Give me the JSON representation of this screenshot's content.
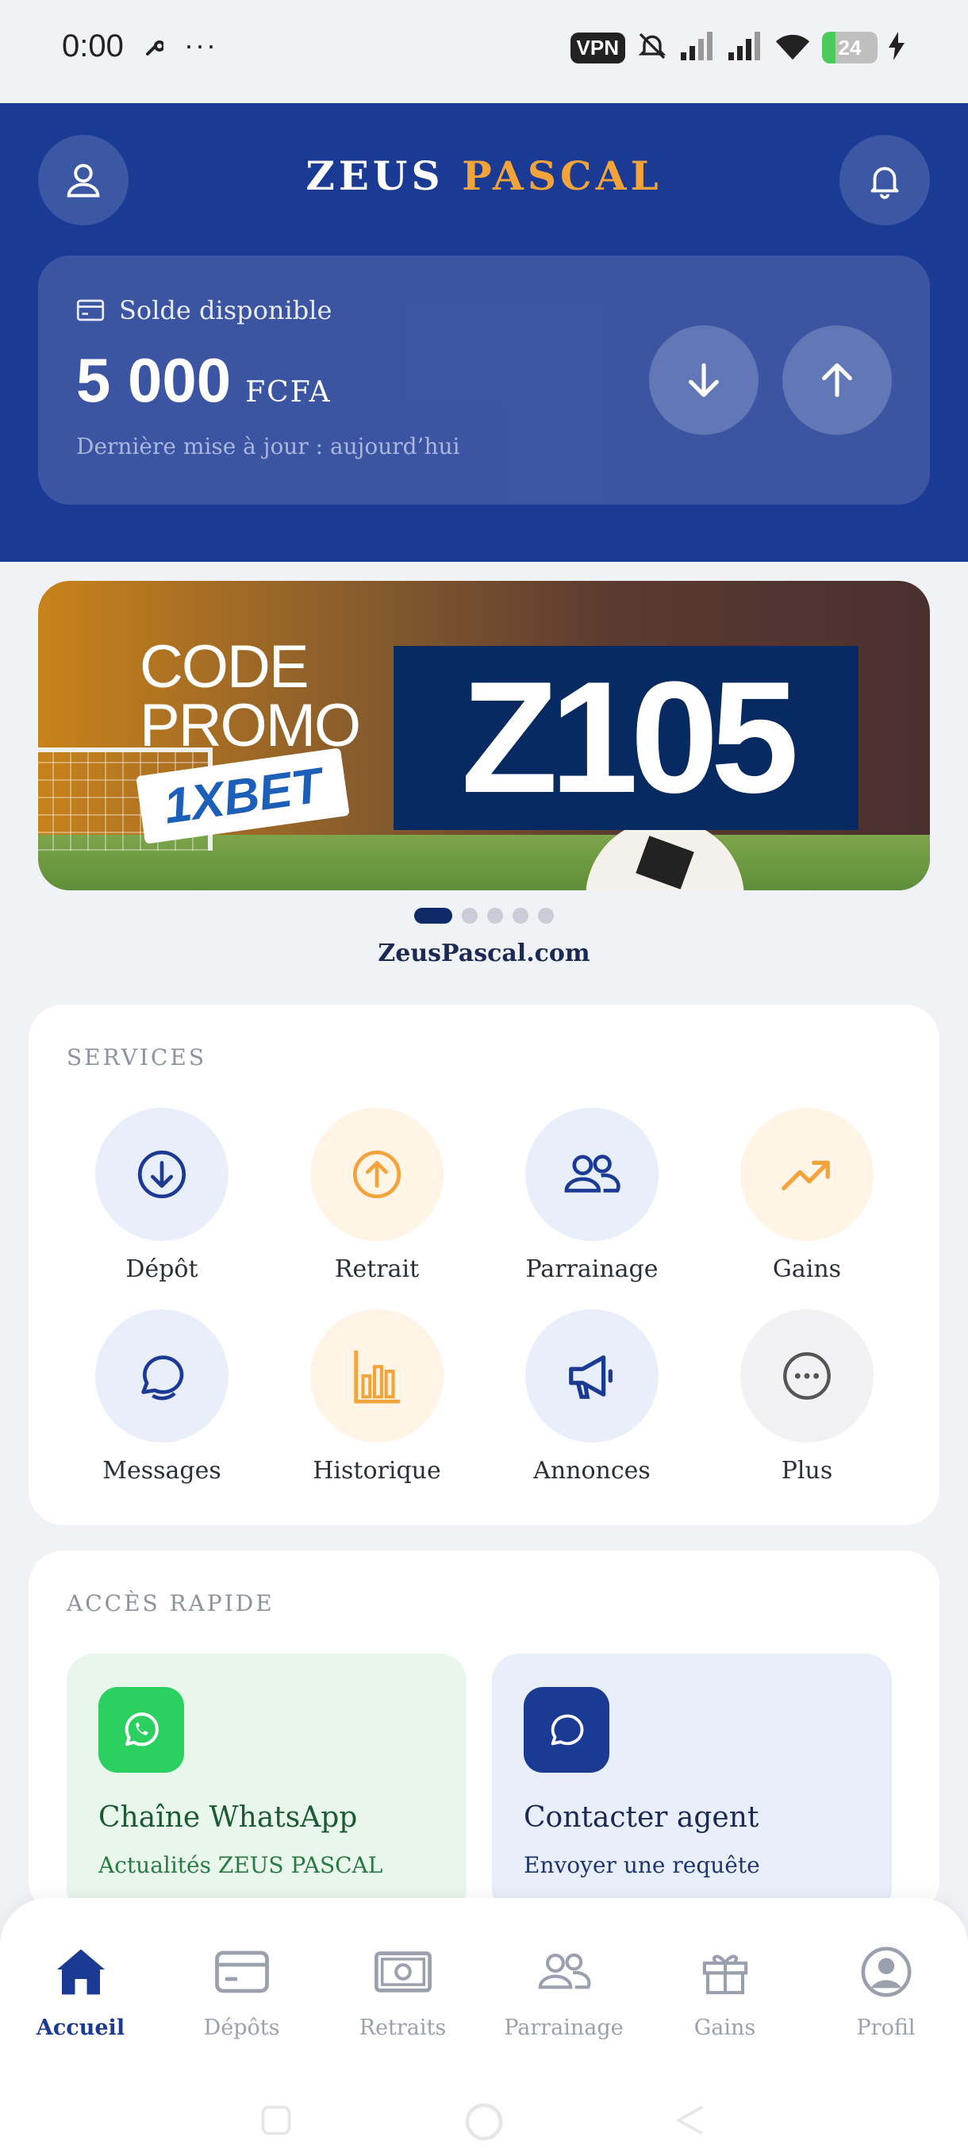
{
  "status_bar": {
    "time": "0:00",
    "dots": "···",
    "vpn": "VPN",
    "battery": "24",
    "icons": [
      "wrench-icon",
      "more-icon",
      "vpn-badge",
      "bell-off-icon",
      "signal-icon",
      "signal-icon",
      "wifi-icon",
      "battery-icon",
      "charging-icon"
    ]
  },
  "header": {
    "brand_part1": "ZEUS",
    "brand_part2": "PASCAL",
    "colors": {
      "primary": "#1b3a94",
      "accent": "#f2a43a"
    }
  },
  "balance": {
    "label": "Solde disponible",
    "amount": "5 000",
    "currency": "FCFA",
    "updated": "Dernière mise à jour : aujourd’hui",
    "actions": [
      "deposit-arrow-down",
      "withdraw-arrow-up"
    ]
  },
  "banner": {
    "line1": "CODE",
    "line2": "PROMO",
    "brand": "1XBET",
    "code": "Z105",
    "slides": 5,
    "active_slide": 1,
    "site": "ZeusPascal.com"
  },
  "services": {
    "title": "SERVICES",
    "items": [
      {
        "label": "Dépôt",
        "icon": "arrow-down-circle-icon"
      },
      {
        "label": "Retrait",
        "icon": "arrow-up-circle-icon"
      },
      {
        "label": "Parrainage",
        "icon": "users-icon"
      },
      {
        "label": "Gains",
        "icon": "trending-up-icon"
      },
      {
        "label": "Messages",
        "icon": "chat-icon"
      },
      {
        "label": "Historique",
        "icon": "bar-chart-icon"
      },
      {
        "label": "Annonces",
        "icon": "megaphone-icon"
      },
      {
        "label": "Plus",
        "icon": "more-circle-icon"
      }
    ]
  },
  "quick_access": {
    "title": "ACCÈS RAPIDE",
    "whatsapp": {
      "title": "Chaîne WhatsApp",
      "subtitle": "Actualités ZEUS PASCAL"
    },
    "agent": {
      "title": "Contacter agent",
      "subtitle": "Envoyer une requête"
    }
  },
  "bottom_nav": {
    "items": [
      {
        "label": "Accueil",
        "icon": "home-icon",
        "active": true
      },
      {
        "label": "Dépôts",
        "icon": "card-icon",
        "active": false
      },
      {
        "label": "Retraits",
        "icon": "banknote-icon",
        "active": false
      },
      {
        "label": "Parrainage",
        "icon": "users-icon",
        "active": false
      },
      {
        "label": "Gains",
        "icon": "gift-icon",
        "active": false
      },
      {
        "label": "Profil",
        "icon": "user-circle-icon",
        "active": false
      }
    ]
  }
}
